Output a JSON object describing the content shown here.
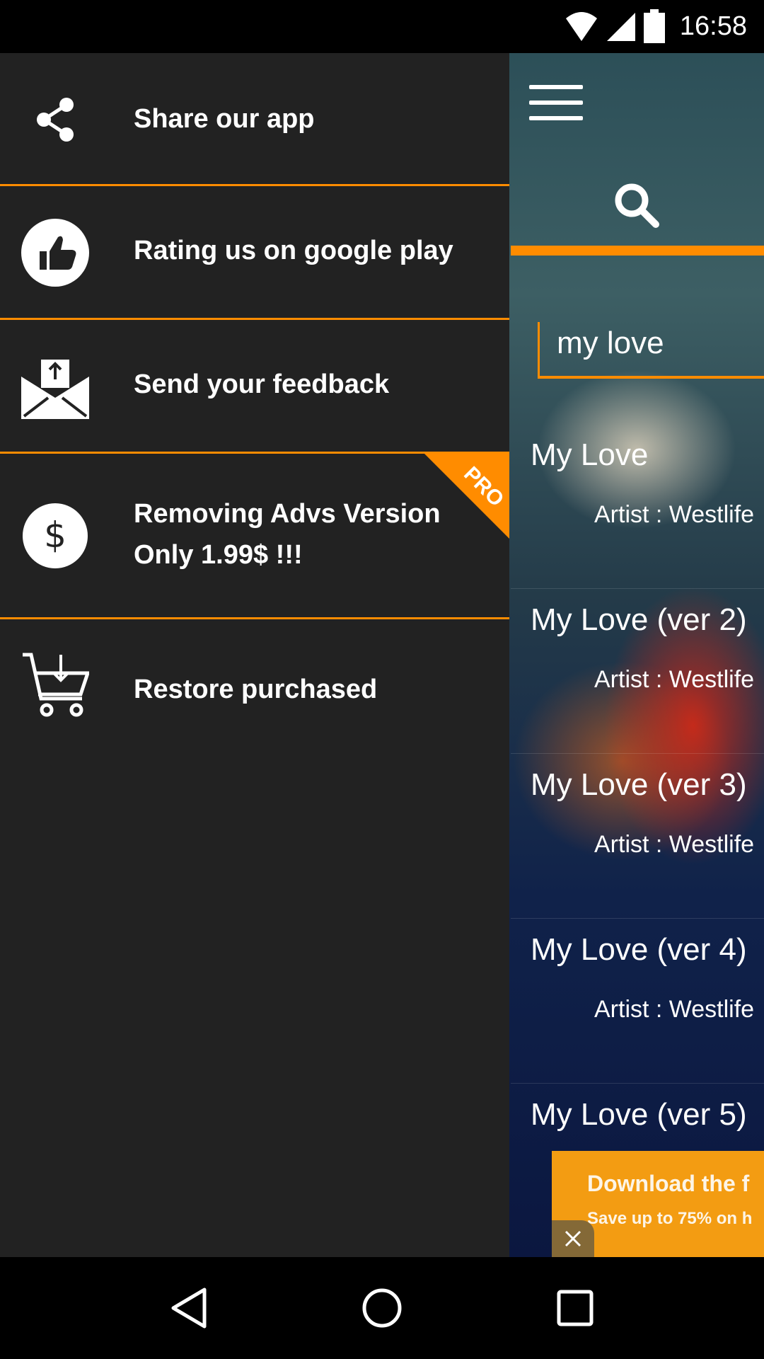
{
  "status_bar": {
    "time": "16:58",
    "icons": [
      "wifi-icon",
      "signal-icon",
      "battery-icon"
    ]
  },
  "drawer": {
    "items": [
      {
        "label": "Share our app",
        "icon": "share-icon"
      },
      {
        "label": "Rating us on google play",
        "icon": "thumbs-up-icon"
      },
      {
        "label": "Send your feedback",
        "icon": "mail-upload-icon"
      },
      {
        "label_line1": "Removing Advs Version",
        "label_line2": "Only 1.99$ !!!",
        "icon": "dollar-icon",
        "badge": "PRO"
      },
      {
        "label": "Restore purchased",
        "icon": "cart-download-icon"
      }
    ]
  },
  "main": {
    "search_value": "my love",
    "results": [
      {
        "title": "My Love",
        "artist": "Artist : Westlife"
      },
      {
        "title": "My Love (ver 2)",
        "artist": "Artist : Westlife"
      },
      {
        "title": "My Love (ver 3)",
        "artist": "Artist : Westlife"
      },
      {
        "title": "My Love (ver 4)",
        "artist": "Artist : Westlife"
      },
      {
        "title": "My Love (ver 5)",
        "artist": ""
      }
    ]
  },
  "ad": {
    "headline": "Download the f",
    "subline": "Save up to 75% on h"
  },
  "colors": {
    "accent": "#ff8c00",
    "drawer_bg": "#222222"
  }
}
